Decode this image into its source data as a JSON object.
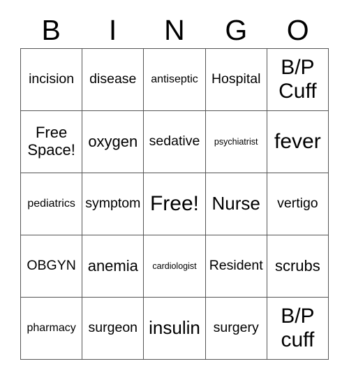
{
  "header": {
    "letters": [
      "B",
      "I",
      "N",
      "G",
      "O"
    ]
  },
  "grid": {
    "rows": 5,
    "columns": 5,
    "border_color": "#555555",
    "text_color": "#000000",
    "background_color": "#ffffff",
    "cells": [
      {
        "text": "incision",
        "size": "md"
      },
      {
        "text": "disease",
        "size": "md"
      },
      {
        "text": "antiseptic",
        "size": "sm"
      },
      {
        "text": "Hospital",
        "size": "md"
      },
      {
        "text": "B/P Cuff",
        "size": "xxl"
      },
      {
        "text": "Free Space!",
        "size": "lg"
      },
      {
        "text": "oxygen",
        "size": "lg"
      },
      {
        "text": "sedative",
        "size": "md"
      },
      {
        "text": "psychiatrist",
        "size": "xs"
      },
      {
        "text": "fever",
        "size": "xxl"
      },
      {
        "text": "pediatrics",
        "size": "sm"
      },
      {
        "text": "symptom",
        "size": "md"
      },
      {
        "text": "Free!",
        "size": "xxl"
      },
      {
        "text": "Nurse",
        "size": "xl"
      },
      {
        "text": "vertigo",
        "size": "md"
      },
      {
        "text": "OBGYN",
        "size": "md"
      },
      {
        "text": "anemia",
        "size": "lg"
      },
      {
        "text": "cardiologist",
        "size": "xs"
      },
      {
        "text": "Resident",
        "size": "md"
      },
      {
        "text": "scrubs",
        "size": "lg"
      },
      {
        "text": "pharmacy",
        "size": "sm"
      },
      {
        "text": "surgeon",
        "size": "md"
      },
      {
        "text": "insulin",
        "size": "xl"
      },
      {
        "text": "surgery",
        "size": "md"
      },
      {
        "text": "B/P cuff",
        "size": "xxl"
      }
    ]
  }
}
